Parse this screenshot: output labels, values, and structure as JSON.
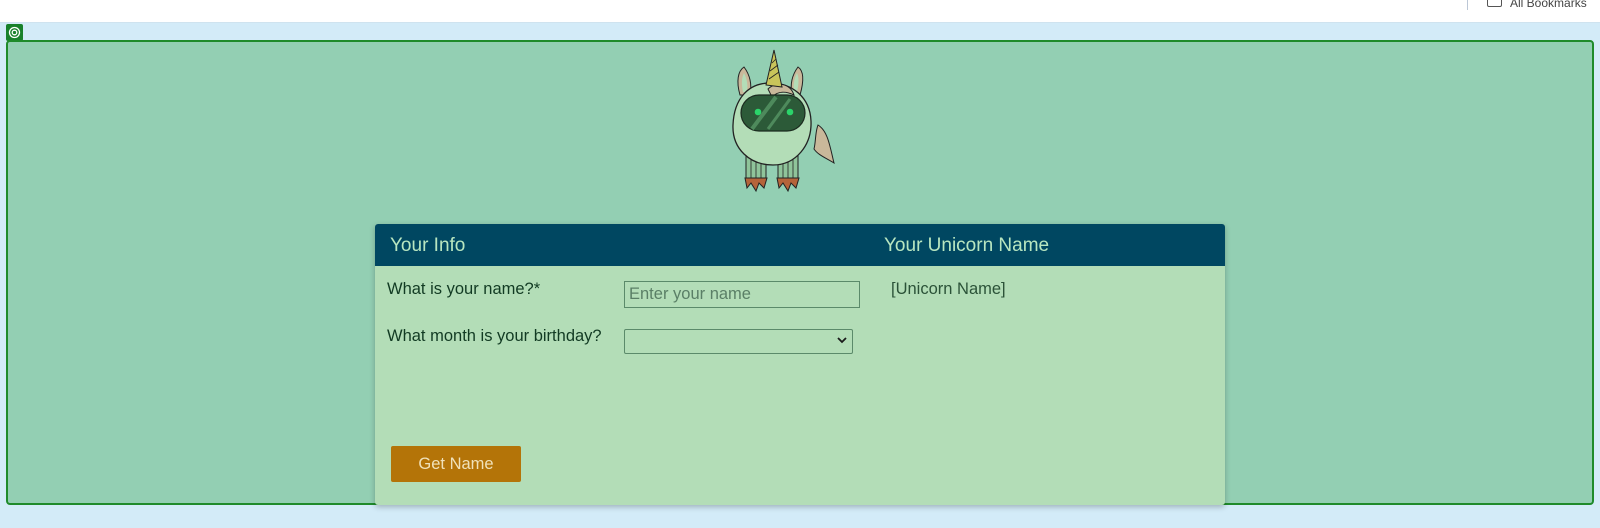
{
  "browser": {
    "bookmarks_label": "All Bookmarks"
  },
  "form": {
    "header_left": "Your Info",
    "header_right": "Your Unicorn Name",
    "name_label": "What is your name?*",
    "name_placeholder": "Enter your name",
    "name_value": "",
    "birthday_label": "What month is your birthday?",
    "birthday_selected": "",
    "result_text": "[Unicorn Name]",
    "button_label": "Get Name"
  },
  "colors": {
    "page_background": "#d3ebf8",
    "frame_background": "#93cfb3",
    "frame_border": "#1f8b2b",
    "card_background": "#b3ddb7",
    "header_background": "#004761",
    "header_text": "#b8e6c0",
    "button_background": "#b47408",
    "button_text": "#f0e1b9"
  },
  "icons": {
    "bookmark": "folder-icon",
    "inspector": "target-icon",
    "mascot": "unicorn-robot-icon",
    "select": "chevron-down-icon"
  }
}
